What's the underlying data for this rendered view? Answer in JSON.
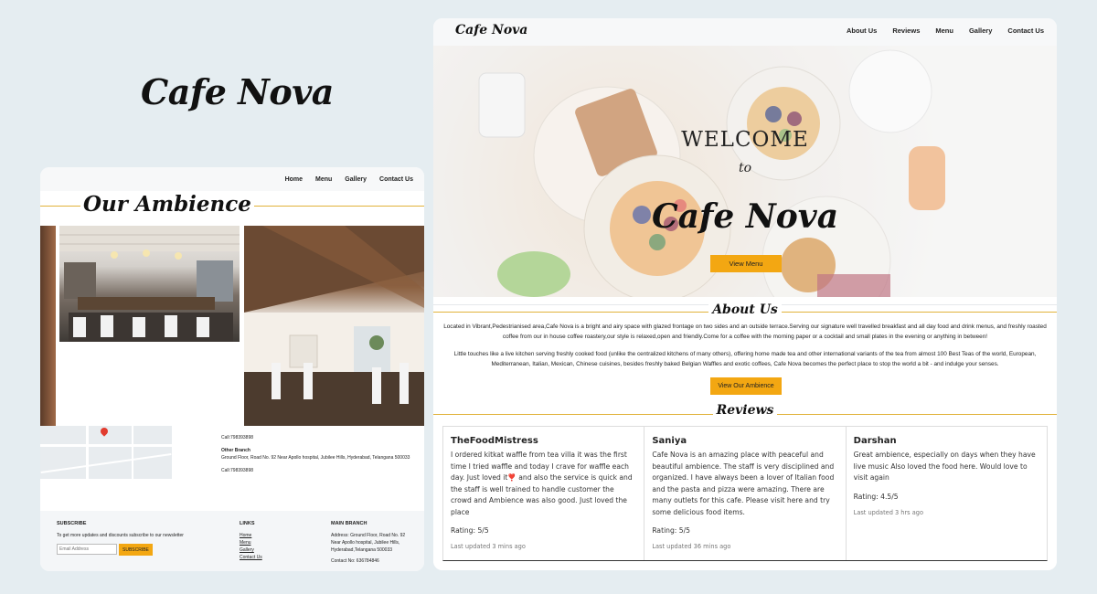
{
  "brand": "Cafe Nova",
  "left_page": {
    "nav": [
      "Home",
      "Menu",
      "Gallery",
      "Contact Us"
    ],
    "ambience_title": "Our Ambience",
    "call_1": "Call:798393898",
    "other_branch_label": "Other Branch",
    "other_branch_address": "Ground Floor, Road No. 92 Near Apollo hospital, Jubilee Hills, Hyderabad, Telangana 500033",
    "call_2": "Call:798393898",
    "footer": {
      "subscribe_heading": "SUBSCRIBE",
      "subscribe_text": "To get more updates and discounts subscribe to our newsletter",
      "email_placeholder": "Email Address",
      "subscribe_button": "SUBSCRIBE",
      "links_heading": "LINKS",
      "links": [
        "Home",
        "Menu",
        "Gallery",
        "Contact Us"
      ],
      "main_branch_heading": "MAIN BRANCH",
      "main_branch_address": "Address: Ground Floor, Road No. 92 Near Apollo hospital, Jubilee Hills, Hyderabad,Telangana 500033",
      "contact": "Contact No: 636784846"
    }
  },
  "right_page": {
    "nav_brand": "Cafe Nova",
    "nav": [
      "About Us",
      "Reviews",
      "Menu",
      "Gallery",
      "Contact Us"
    ],
    "hero_welcome": "WELCOME",
    "hero_to": "to",
    "hero_brand": "Cafe Nova",
    "view_menu": "View Menu",
    "about_title": "About Us",
    "about_p1": "Located in Vibrant,Pedestrianised area,Cafe Nova is a bright and airy space with glazed frontage on two sides and an outside terrace.Serving our signature well travelled breakfast and all day food and drink menus, and freshly roasted coffee from our in house coffee roastery,our style is relaxed,open and friendly.Come for a coffee with the morning paper or a cocktail and small plates in the evening or anything in between!",
    "about_p2": "Little touches like a live kitchen serving freshly cooked food (unlike the centralized kitchens of many others), offering home made tea and other international variants of the tea from almost 100 Best Teas of the world, European, Mediterranean, Italian, Mexican, Chinese cuisines, besides freshly baked Belgian Waffles and exotic coffees, Cafe Nova becomes the perfect place to stop the world a bit - and indulge your senses.",
    "ambience_button": "View Our Ambience",
    "reviews_title": "Reviews",
    "reviews": [
      {
        "name": "TheFoodMistress",
        "text": "I ordered kitkat waffle from tea villa it was the first time I tried waffle and today I crave for waffle each day. Just loved it❣️ and also the service is quick and the staff is well trained to handle customer the crowd and Ambience was also good. Just loved the place",
        "rating": "Rating: 5/5",
        "updated": "Last updated 3 mins ago"
      },
      {
        "name": "Saniya",
        "text": "Cafe Nova is an amazing place with peaceful and beautiful ambience. The staff is very disciplined and organized. I have always been a lover of Italian food and the pasta and pizza were amazing. There are many outlets for this cafe. Please visit here and try some delicious food items.",
        "rating": "Rating: 5/5",
        "updated": "Last updated 36 mins ago"
      },
      {
        "name": "Darshan",
        "text": "Great ambience, especially on days when they have live music Also loved the food here. Would love to visit again",
        "rating": "Rating: 4.5/5",
        "updated": "Last updated 3 hrs ago"
      }
    ]
  },
  "colors": {
    "accent": "#f3a712",
    "rule": "#e1b23a",
    "background": "#e5edf1"
  }
}
